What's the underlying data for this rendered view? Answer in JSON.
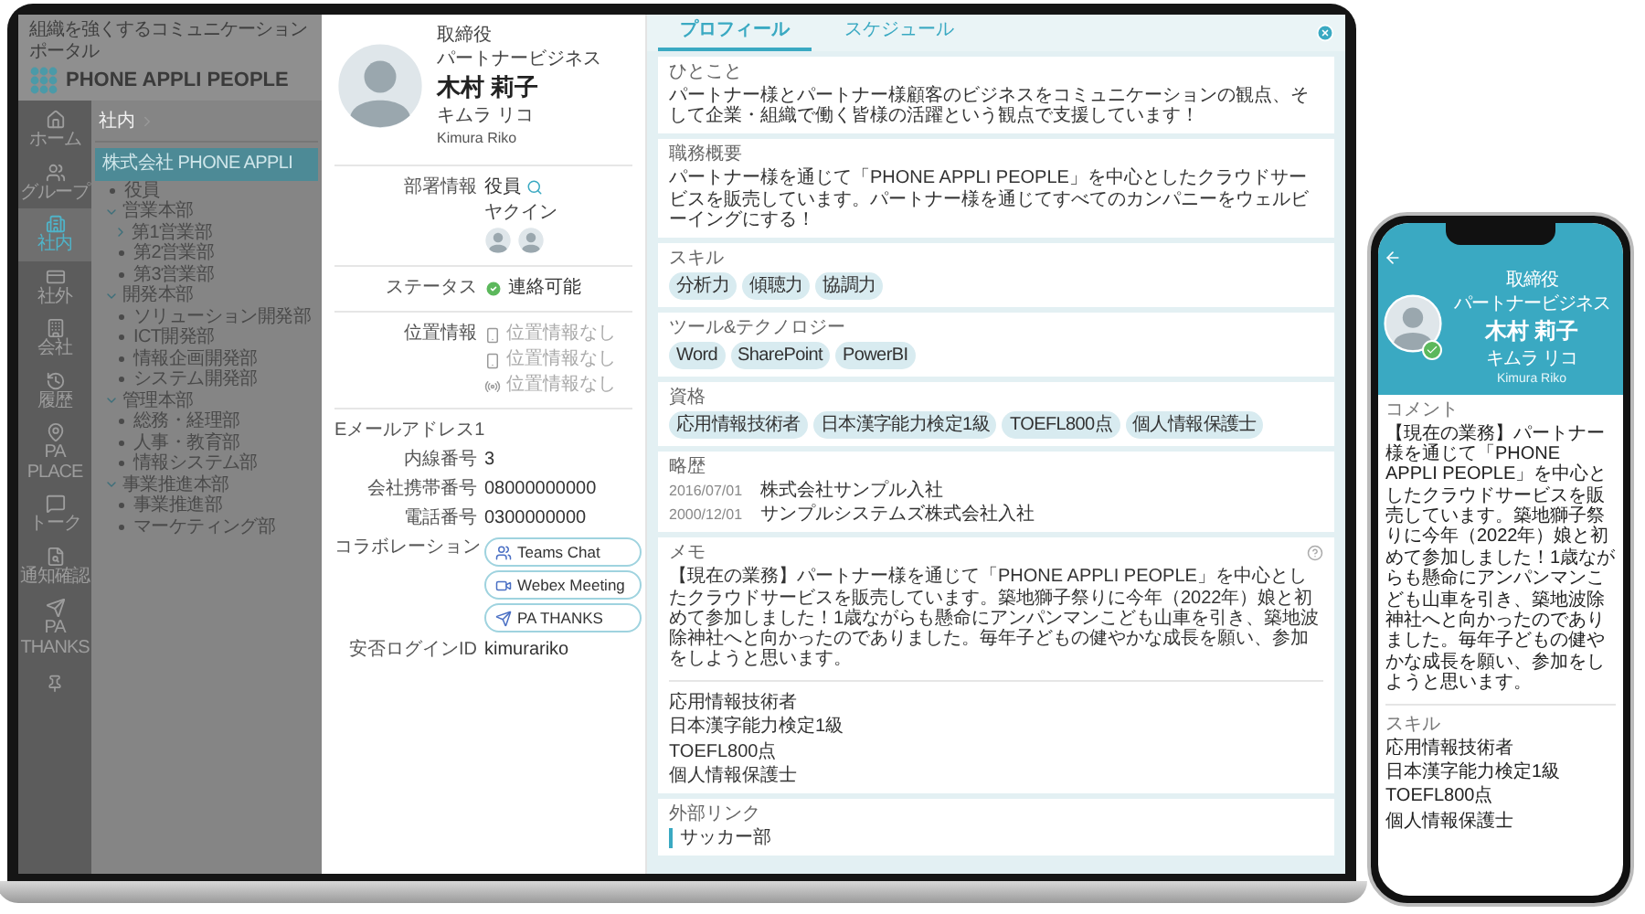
{
  "portal": {
    "tagline": "組織を強くするコミュニケーションポータル",
    "logo": "PHONE APPLI PEOPLE",
    "breadcrumb": "社内"
  },
  "nav": [
    {
      "label": "ホーム",
      "selected": false
    },
    {
      "label": "グループ",
      "selected": false
    },
    {
      "label": "社内",
      "selected": true
    },
    {
      "label": "社外",
      "selected": false
    },
    {
      "label": "会社",
      "selected": false
    },
    {
      "label": "履歴",
      "selected": false
    },
    {
      "label": "PA PLACE",
      "selected": false
    },
    {
      "label": "トーク",
      "selected": false
    },
    {
      "label": "通知確認",
      "selected": false
    },
    {
      "label": "PA THANKS",
      "selected": false
    }
  ],
  "tree": [
    {
      "label": "株式会社 PHONE APPLI",
      "selected": true,
      "children": [
        {
          "label": "役員",
          "selected": false
        },
        {
          "label": "営業本部",
          "selected": false,
          "expanded": true,
          "children": [
            {
              "label": "第1営業部",
              "selected": false,
              "expanded": false
            },
            {
              "label": "第2営業部",
              "selected": false
            },
            {
              "label": "第3営業部",
              "selected": false
            }
          ]
        },
        {
          "label": "開発本部",
          "selected": false,
          "expanded": true,
          "children": [
            {
              "label": "ソリューション開発部",
              "selected": false
            },
            {
              "label": "ICT開発部",
              "selected": false
            },
            {
              "label": "情報企画開発部",
              "selected": false
            },
            {
              "label": "システム開発部",
              "selected": false
            }
          ]
        },
        {
          "label": "管理本部",
          "selected": false,
          "expanded": true,
          "children": [
            {
              "label": "総務・経理部",
              "selected": false
            },
            {
              "label": "人事・教育部",
              "selected": false
            },
            {
              "label": "情報システム部",
              "selected": false
            }
          ]
        },
        {
          "label": "事業推進本部",
          "selected": false,
          "expanded": true,
          "children": [
            {
              "label": "事業推進部",
              "selected": false
            },
            {
              "label": "マーケティング部",
              "selected": false
            }
          ]
        }
      ]
    }
  ],
  "profile": {
    "title": "取締役",
    "department": "パートナービジネス",
    "name": "木村 莉子",
    "kana": "キムラ リコ",
    "roman": "Kimura Riko",
    "fields": [
      {
        "kind": "department",
        "label": "部署情報",
        "value": "役員",
        "reading": "ヤクイン"
      },
      {
        "kind": "status",
        "label": "ステータス",
        "value": "連絡可能",
        "online": true
      },
      {
        "kind": "location",
        "label": "位置情報",
        "values": [
          "位置情報なし",
          "位置情報なし",
          "位置情報なし"
        ]
      },
      {
        "kind": "contact",
        "label": "Eメールアドレス1"
      },
      {
        "kind": "contact",
        "label": "内線番号",
        "value": "3"
      },
      {
        "kind": "contact",
        "label": "会社携帯番号",
        "value": "08000000000"
      },
      {
        "kind": "contact",
        "label": "電話番号",
        "value": "0300000000"
      },
      {
        "kind": "collaboration",
        "label": "コラボレーション",
        "buttons": [
          "Teams Chat",
          "Webex Meeting",
          "PA THANKS"
        ]
      },
      {
        "kind": "contact",
        "label": "安否ログインID",
        "value": "kimurariko"
      }
    ]
  },
  "tabs": [
    {
      "label": "プロフィール",
      "selected": true
    },
    {
      "label": "スケジュール",
      "selected": false
    }
  ],
  "sections": [
    {
      "kind": "text",
      "label": "ひとこと",
      "text": "パートナー様とパートナー様顧客のビジネスをコミュニケーションの観点、そして企業・組織で働く皆様の活躍という観点で支援しています！"
    },
    {
      "kind": "text",
      "label": "職務概要",
      "text": "パートナー様を通じて「PHONE APPLI PEOPLE」を中心としたクラウドサービスを販売しています。パートナー様を通じてすべてのカンパニーをウェルビーイングにする！"
    },
    {
      "kind": "tags",
      "label": "スキル",
      "tags": [
        "分析力",
        "傾聴力",
        "協調力"
      ]
    },
    {
      "kind": "tags",
      "label": "ツール&テクノロジー",
      "tags": [
        "Word",
        "SharePoint",
        "PowerBI"
      ]
    },
    {
      "kind": "tags",
      "label": "資格",
      "tags": [
        "応用情報技術者",
        "日本漢字能力検定1級",
        "TOEFL800点",
        "個人情報保護士"
      ]
    },
    {
      "kind": "history",
      "label": "略歴",
      "items": [
        {
          "date": "2016/07/01",
          "text": "株式会社サンプル入社"
        },
        {
          "date": "2000/12/01",
          "text": "サンプルシステムズ株式会社入社"
        }
      ]
    },
    {
      "kind": "memo",
      "label": "メモ",
      "text": "【現在の業務】パートナー様を通じて「PHONE APPLI PEOPLE」を中心としたクラウドサービスを販売しています。築地獅子祭りに今年（2022年）娘と初めて参加しました！1歳ながらも懸命にアンパンマンこども山車を引き、築地波除神社へと向かったのでありました。毎年子どもの健やかな成長を願い、参加をしようと思います。",
      "lines": [
        "応用情報技術者",
        "日本漢字能力検定1級",
        "TOEFL800点",
        "個人情報保護士"
      ]
    },
    {
      "kind": "links",
      "label": "外部リンク",
      "links": [
        "サッカー部"
      ]
    }
  ],
  "phone": {
    "title": "取締役",
    "department": "パートナービジネス",
    "name": "木村 莉子",
    "kana": "キムラ リコ",
    "roman": "Kimura Riko",
    "online": true,
    "comment_label": "コメント",
    "comment": "【現在の業務】パートナー様を通じて「PHONE APPLI PEOPLE」を中心としたクラウドサービスを販売しています。築地獅子祭りに今年（2022年）娘と初めて参加しました！1歳ながらも懸命にアンパンマンこども山車を引き、築地波除神社へと向かったのでありました。毎年子どもの健やかな成長を願い、参加をしようと思います。",
    "skills_label": "スキル",
    "skills": [
      "応用情報技術者",
      "日本漢字能力検定1級",
      "TOEFL800点",
      "個人情報保護士"
    ]
  }
}
